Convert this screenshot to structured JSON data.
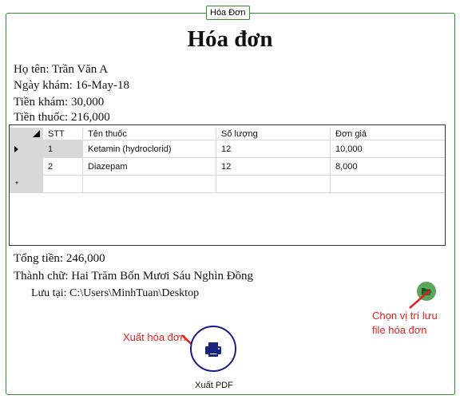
{
  "group": {
    "legend": "Hóa Đơn"
  },
  "title": "Hóa đơn",
  "info": {
    "name": "Họ tên: Trần Văn A",
    "date": "Ngày khám: 16-May-18",
    "exam_fee": "Tiền khám: 30,000",
    "medicine_fee": "Tiền thuốc: 216,000"
  },
  "grid": {
    "columns": [
      "STT",
      "Tên thuốc",
      "Số lượng",
      "Đơn giá"
    ],
    "rows": [
      [
        "1",
        "Ketamin (hydroclorid)",
        "12",
        "10,000"
      ],
      [
        "2",
        "Diazepam",
        "12",
        "8,000"
      ]
    ],
    "new_row_marker": "*"
  },
  "summary": {
    "total": "Tổng tiền: 246,000",
    "in_words": "Thành chữ: Hai Trăm Bốn Mươi Sáu Nghìn Đồng",
    "save_path": "Lưu tại: C:\\Users\\MinhTuan\\Desktop"
  },
  "annotations": {
    "choose_location_1": "Chọn vị trí lưu",
    "choose_location_2": "file hóa đơn",
    "export_invoice": "Xuất hóa đơn"
  },
  "export_button": {
    "label": "Xuất PDF",
    "icon": "printer-icon"
  },
  "folder_button": {
    "icon": "folder-open-icon"
  },
  "colors": {
    "border": "#2e8b2e",
    "annotation": "#e02020",
    "button_ring": "#1a1a8c",
    "printer": "#1a237e",
    "folder": "#5aa65a"
  }
}
